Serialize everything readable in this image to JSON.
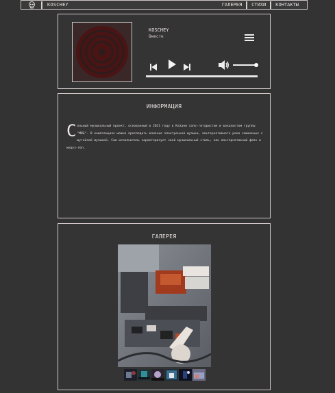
{
  "topbar": {
    "brand": "KOSCHEY",
    "nav": [
      {
        "label": "ГАЛЕРЕЯ"
      },
      {
        "label": "СТИХИ"
      },
      {
        "label": "КОНТАКТЫ"
      }
    ]
  },
  "player": {
    "artist": "KOSCHEY",
    "track_title": "Вместе",
    "cover_icon": "vinyl-record-icon",
    "volume_level": 0.95,
    "progress": 0.0
  },
  "info": {
    "title": "ИНФОРМАЦИЯ",
    "drop_cap": "С",
    "body": "ольный музыкальный проект, основанный в 2021 году в Казани соло-гитаристом и вокалистом группы \"МВБ\". В композициях можно проследить влияние электронной музыки, альтернативного рока смешанных с шугейзой музыкой. Сам исполнитель характеризует свой музыкальный стиль, как альтернативный фолк и индуз-поп."
  },
  "gallery": {
    "title": "ГАЛЕРЕЯ",
    "thumbnail_count": 6
  },
  "colors": {
    "background": "#333333",
    "border": "#d8cfcf",
    "cover_disc": "#4a1414",
    "cover_bg": "#3a2727"
  }
}
